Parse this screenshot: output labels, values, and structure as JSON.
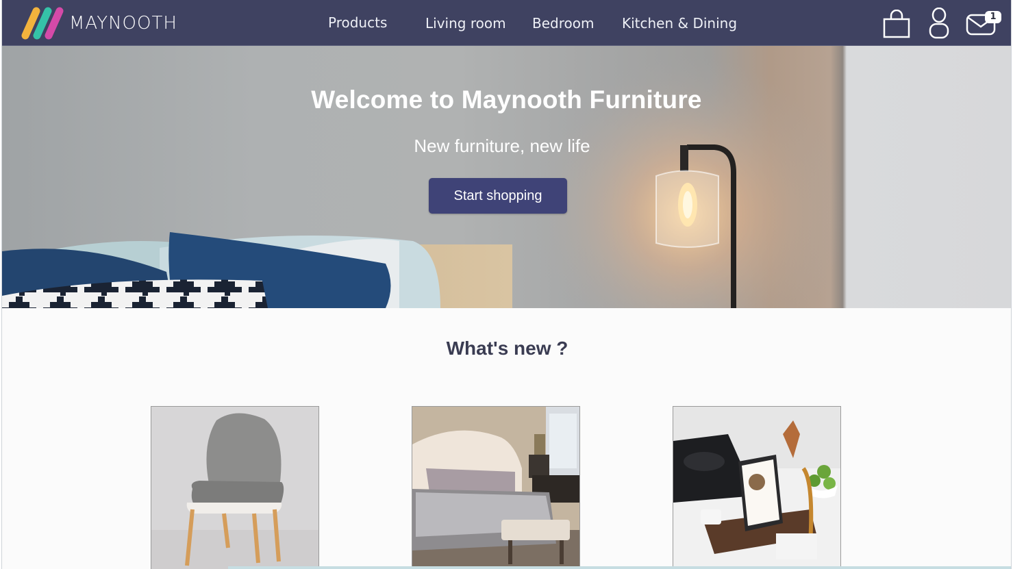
{
  "brand": {
    "name": "MAYNOOTH",
    "colors": {
      "navbar": "#3f4261",
      "accent_button": "#3f4377",
      "heading": "#3a3c52"
    },
    "logo_stripes": [
      "#f3b33d",
      "#35c2a8",
      "#d54aa8"
    ]
  },
  "nav": {
    "items": [
      {
        "label": "Products"
      },
      {
        "label": "Living room"
      },
      {
        "label": "Bedroom"
      },
      {
        "label": "Kitchen & Dining"
      }
    ],
    "icons": {
      "bag": "shopping-bag-icon",
      "user": "user-icon",
      "mail": "mail-icon"
    },
    "message_count": "1"
  },
  "hero": {
    "title": "Welcome to Maynooth Furniture",
    "subtitle": "New furniture, new life",
    "cta_label": "Start shopping"
  },
  "whats_new": {
    "title": "What's new ?",
    "cards": [
      {
        "image": "grey-armchair"
      },
      {
        "image": "tufted-bed"
      },
      {
        "image": "kitchen-tablet-stand"
      }
    ]
  }
}
